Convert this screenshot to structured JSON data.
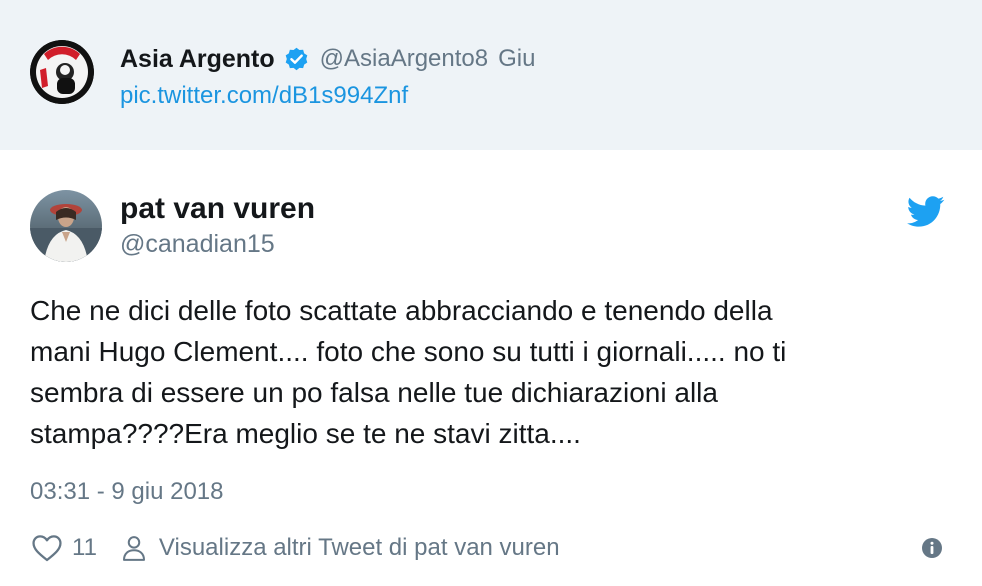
{
  "quoted_tweet": {
    "author_name": "Asia Argento",
    "verified": true,
    "handle": "@AsiaArgento8",
    "date": "Giu",
    "link": "pic.twitter.com/dB1s994Znf"
  },
  "tweet": {
    "author_name": "pat van vuren",
    "handle": "@canadian15",
    "text_lines": [
      "Che ne dici delle foto scattate abbracciando e tenendo della",
      "mani Hugo Clement.... foto che sono su tutti i giornali..... no ti",
      "sembra di essere un po falsa nelle tue dichiarazioni  alla",
      "stampa????Era meglio se te ne stavi zitta...."
    ],
    "timestamp": "03:31 - 9 giu 2018"
  },
  "actions": {
    "like_count": "11",
    "view_more": "Visualizza altri Tweet di pat van vuren"
  },
  "icons": {
    "verified": "verified-badge-icon",
    "bird": "twitter-bird-icon",
    "heart": "heart-icon",
    "person": "person-icon",
    "info": "info-icon"
  },
  "colors": {
    "link": "#1b95e0",
    "secondary_text": "#657786",
    "quoted_background": "#eef3f7",
    "twitter_blue": "#1da1f2"
  }
}
